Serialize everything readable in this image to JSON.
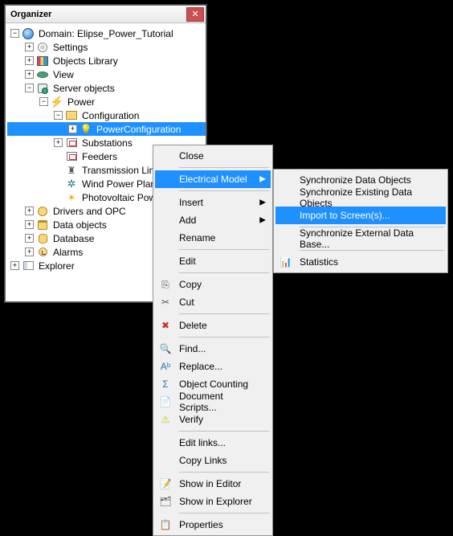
{
  "panel": {
    "title": "Organizer"
  },
  "tree": {
    "domain": {
      "label": "Domain: Elipse_Power_Tutorial",
      "toggle": "−"
    },
    "settings": {
      "label": "Settings",
      "toggle": "+"
    },
    "library": {
      "label": "Objects Library",
      "toggle": "+"
    },
    "view": {
      "label": "View",
      "toggle": "+"
    },
    "server": {
      "label": "Server objects",
      "toggle": "−"
    },
    "power": {
      "label": "Power",
      "toggle": "−"
    },
    "config": {
      "label": "Configuration",
      "toggle": "−"
    },
    "powerconfig": {
      "label": "PowerConfiguration",
      "toggle": "+"
    },
    "substations": {
      "label": "Substations",
      "toggle": "+"
    },
    "feeders": {
      "label": "Feeders",
      "toggle": ""
    },
    "transmission": {
      "label": "Transmission Lines",
      "toggle": ""
    },
    "wind": {
      "label": "Wind Power Plants",
      "toggle": ""
    },
    "pv": {
      "label": "Photovoltaic Power Plants",
      "toggle": ""
    },
    "drivers": {
      "label": "Drivers and OPC",
      "toggle": "+"
    },
    "dataobj": {
      "label": "Data objects",
      "toggle": "+"
    },
    "database": {
      "label": "Database",
      "toggle": "+"
    },
    "alarms": {
      "label": "Alarms",
      "toggle": "+"
    },
    "explorer": {
      "label": "Explorer",
      "toggle": "+"
    }
  },
  "menu1": {
    "close": "Close",
    "elec": "Electrical Model",
    "insert": "Insert",
    "add": "Add",
    "rename": "Rename",
    "edit": "Edit",
    "copy": "Copy",
    "cut": "Cut",
    "delete": "Delete",
    "find": "Find...",
    "replace": "Replace...",
    "objcnt": "Object Counting",
    "docscr": "Document Scripts...",
    "verify": "Verify",
    "editlnk": "Edit links...",
    "copylnk": "Copy Links",
    "shwed": "Show in Editor",
    "shwex": "Show in Explorer",
    "props": "Properties"
  },
  "menu2": {
    "syncdo": "Synchronize Data Objects",
    "syncedo": "Synchronize Existing Data Objects",
    "import": "Import to Screen(s)...",
    "syncext": "Synchronize External Data Base...",
    "stats": "Statistics"
  }
}
